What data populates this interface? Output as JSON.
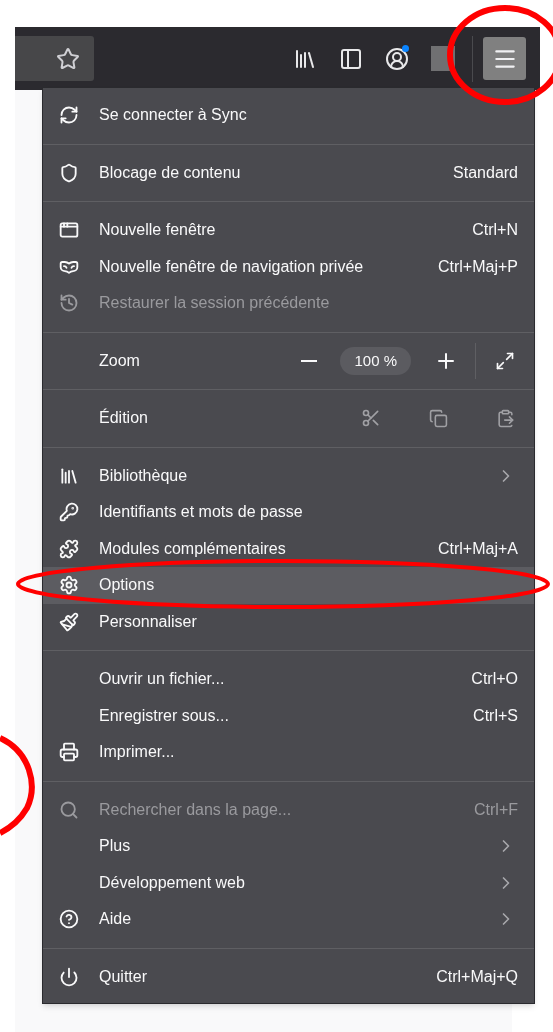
{
  "toolbar": {
    "menu_button": {
      "open": true
    }
  },
  "menu": {
    "sections": [
      {
        "items": [
          {
            "kind": "item",
            "label": "Se connecter à Sync",
            "submenu": false,
            "disabled": false,
            "selected": false
          }
        ]
      },
      {
        "items": [
          {
            "kind": "item",
            "label": "Blocage de contenu",
            "detail": "Standard",
            "submenu": false,
            "disabled": false,
            "selected": false
          }
        ]
      },
      {
        "items": [
          {
            "kind": "item",
            "label": "Nouvelle fenêtre",
            "detail": "Ctrl+N",
            "submenu": false,
            "disabled": false,
            "selected": false
          },
          {
            "kind": "item",
            "label": "Nouvelle fenêtre de navigation privée",
            "detail": "Ctrl+Maj+P",
            "submenu": false,
            "disabled": false,
            "selected": false
          },
          {
            "kind": "item",
            "label": "Restaurer la session précédente",
            "submenu": false,
            "disabled": true,
            "selected": false
          }
        ]
      },
      {
        "items": [
          {
            "kind": "zoom",
            "label": "Zoom",
            "value": "100 %"
          }
        ]
      },
      {
        "items": [
          {
            "kind": "edit",
            "label": "Édition"
          }
        ]
      },
      {
        "items": [
          {
            "kind": "item",
            "label": "Bibliothèque",
            "submenu": true,
            "disabled": false,
            "selected": false
          },
          {
            "kind": "item",
            "label": "Identifiants et mots de passe",
            "submenu": false,
            "disabled": false,
            "selected": false
          },
          {
            "kind": "item",
            "label": "Modules complémentaires",
            "detail": "Ctrl+Maj+A",
            "submenu": false,
            "disabled": false,
            "selected": false
          },
          {
            "kind": "item",
            "label": "Options",
            "submenu": false,
            "disabled": false,
            "selected": true
          },
          {
            "kind": "item",
            "label": "Personnaliser",
            "submenu": false,
            "disabled": false,
            "selected": false
          }
        ]
      },
      {
        "items": [
          {
            "kind": "item",
            "label": "Ouvrir un fichier...",
            "detail": "Ctrl+O",
            "submenu": false,
            "disabled": false,
            "selected": false
          },
          {
            "kind": "item",
            "label": "Enregistrer sous...",
            "detail": "Ctrl+S",
            "submenu": false,
            "disabled": false,
            "selected": false
          },
          {
            "kind": "item",
            "label": "Imprimer...",
            "submenu": false,
            "disabled": false,
            "selected": false
          }
        ]
      },
      {
        "items": [
          {
            "kind": "item",
            "label": "Rechercher dans la page...",
            "detail": "Ctrl+F",
            "submenu": false,
            "disabled": true,
            "selected": false
          },
          {
            "kind": "item",
            "label": "Plus",
            "submenu": true,
            "disabled": false,
            "selected": false
          },
          {
            "kind": "item",
            "label": "Développement web",
            "submenu": true,
            "disabled": false,
            "selected": false
          },
          {
            "kind": "item",
            "label": "Aide",
            "submenu": true,
            "disabled": false,
            "selected": false
          }
        ]
      },
      {
        "items": [
          {
            "kind": "item",
            "label": "Quitter",
            "detail": "Ctrl+Maj+Q",
            "submenu": false,
            "disabled": false,
            "selected": false
          }
        ]
      }
    ]
  }
}
